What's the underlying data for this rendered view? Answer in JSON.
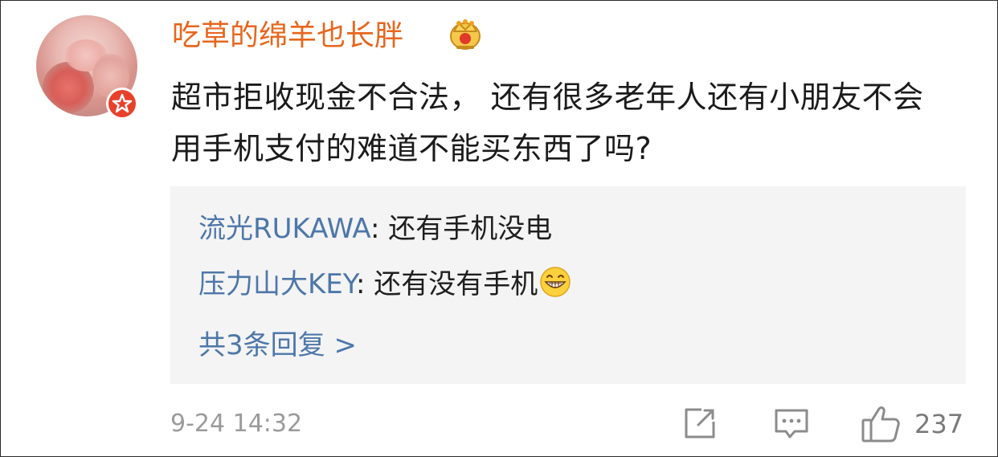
{
  "comment": {
    "username": "吃草的绵羊也长胖",
    "content": "超市拒收现金不合法， 还有很多老年人还有小朋友不会用手机支付的难道不能买东西了吗?",
    "replies": [
      {
        "name": "流光RUKAWA",
        "separator": ": ",
        "text": "还有手机没电"
      },
      {
        "name": "压力山大KEY",
        "separator": ": ",
        "text": "还有没有手机",
        "emoji": "grin-emoji-icon"
      }
    ],
    "more_replies_label": "共3条回复 >",
    "timestamp": "9-24 14:32",
    "like_count": "237"
  },
  "icons": {
    "avatar": "avatar",
    "verified_badge": "verified-star-icon",
    "crown": "crown-icon",
    "share": "share-icon",
    "comment": "comment-icon",
    "like": "thumbs-up-icon"
  },
  "colors": {
    "username": "#e7661d",
    "link": "#4d77a9",
    "reply_bg": "#f4f4f4",
    "meta_gray": "#9b9b9b",
    "badge_red": "#e8412b"
  }
}
